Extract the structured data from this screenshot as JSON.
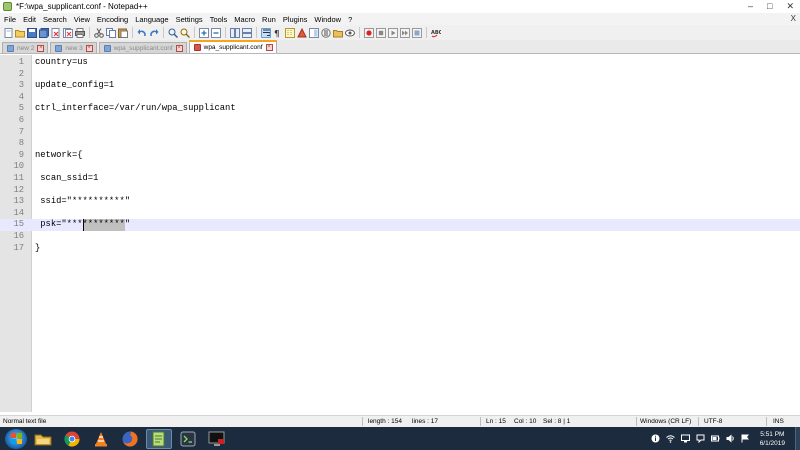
{
  "window": {
    "title": "*F:\\wpa_supplicant.conf - Notepad++",
    "controls": [
      "–",
      "□",
      "✕"
    ]
  },
  "menu": {
    "items": [
      "File",
      "Edit",
      "Search",
      "View",
      "Encoding",
      "Language",
      "Settings",
      "Tools",
      "Macro",
      "Run",
      "Plugins",
      "Window",
      "?"
    ],
    "close": "X"
  },
  "toolbar": {
    "icons": [
      "new-file-icon",
      "open-file-icon",
      "save-icon",
      "save-all-icon",
      "close-file-icon",
      "close-all-icon",
      "print-icon",
      "cut-icon",
      "copy-icon",
      "paste-icon",
      "undo-icon",
      "redo-icon",
      "find-icon",
      "replace-icon",
      "zoom-in-icon",
      "zoom-out-icon",
      "sync-vertical-icon",
      "sync-horizontal-icon",
      "word-wrap-icon",
      "show-all-chars-icon",
      "indent-guide-icon",
      "user-language-icon",
      "document-map-icon",
      "function-list-icon",
      "folder-workspace-icon",
      "monitoring-icon",
      "record-macro-icon",
      "stop-record-icon",
      "play-macro-icon",
      "run-macro-icon",
      "save-macro-icon",
      "spellcheck-icon"
    ]
  },
  "tabs": [
    {
      "label": "new 2",
      "active": false
    },
    {
      "label": "new 3",
      "active": false
    },
    {
      "label": "wpa_supplicant.conf",
      "active": false
    },
    {
      "label": "wpa_supplicant.conf",
      "active": true
    }
  ],
  "editor": {
    "lines": [
      {
        "n": "1",
        "text": "country=us"
      },
      {
        "n": "2",
        "text": ""
      },
      {
        "n": "3",
        "text": "update_config=1"
      },
      {
        "n": "4",
        "text": ""
      },
      {
        "n": "5",
        "text": "ctrl_interface=/var/run/wpa_supplicant"
      },
      {
        "n": "6",
        "text": ""
      },
      {
        "n": "7",
        "text": ""
      },
      {
        "n": "8",
        "text": ""
      },
      {
        "n": "9",
        "text": "network={"
      },
      {
        "n": "10",
        "text": ""
      },
      {
        "n": "11",
        "text": " scan_ssid=1"
      },
      {
        "n": "12",
        "text": ""
      },
      {
        "n": "13",
        "text": " ssid=\"**********\""
      },
      {
        "n": "14",
        "text": ""
      },
      {
        "n": "15",
        "text": " psk=\"***",
        "sel": "********",
        "after": "\""
      },
      {
        "n": "16",
        "text": ""
      },
      {
        "n": "17",
        "text": "}"
      }
    ]
  },
  "status": {
    "file_type": "Normal text file",
    "length": "length : 154",
    "lines": "lines : 17",
    "ln": "Ln : 15",
    "col": "Col : 10",
    "sel": "Sel : 8 | 1",
    "eol": "Windows (CR LF)",
    "encoding": "UTF-8",
    "mode": "INS"
  },
  "taskbar": {
    "apps": [
      "file-explorer-icon",
      "chrome-icon",
      "vlc-icon",
      "firefox-icon",
      "notepadpp-icon",
      "terminal-app-icon",
      "remote-desktop-icon"
    ],
    "time": "5:51 PM",
    "date": "6/1/2019"
  }
}
